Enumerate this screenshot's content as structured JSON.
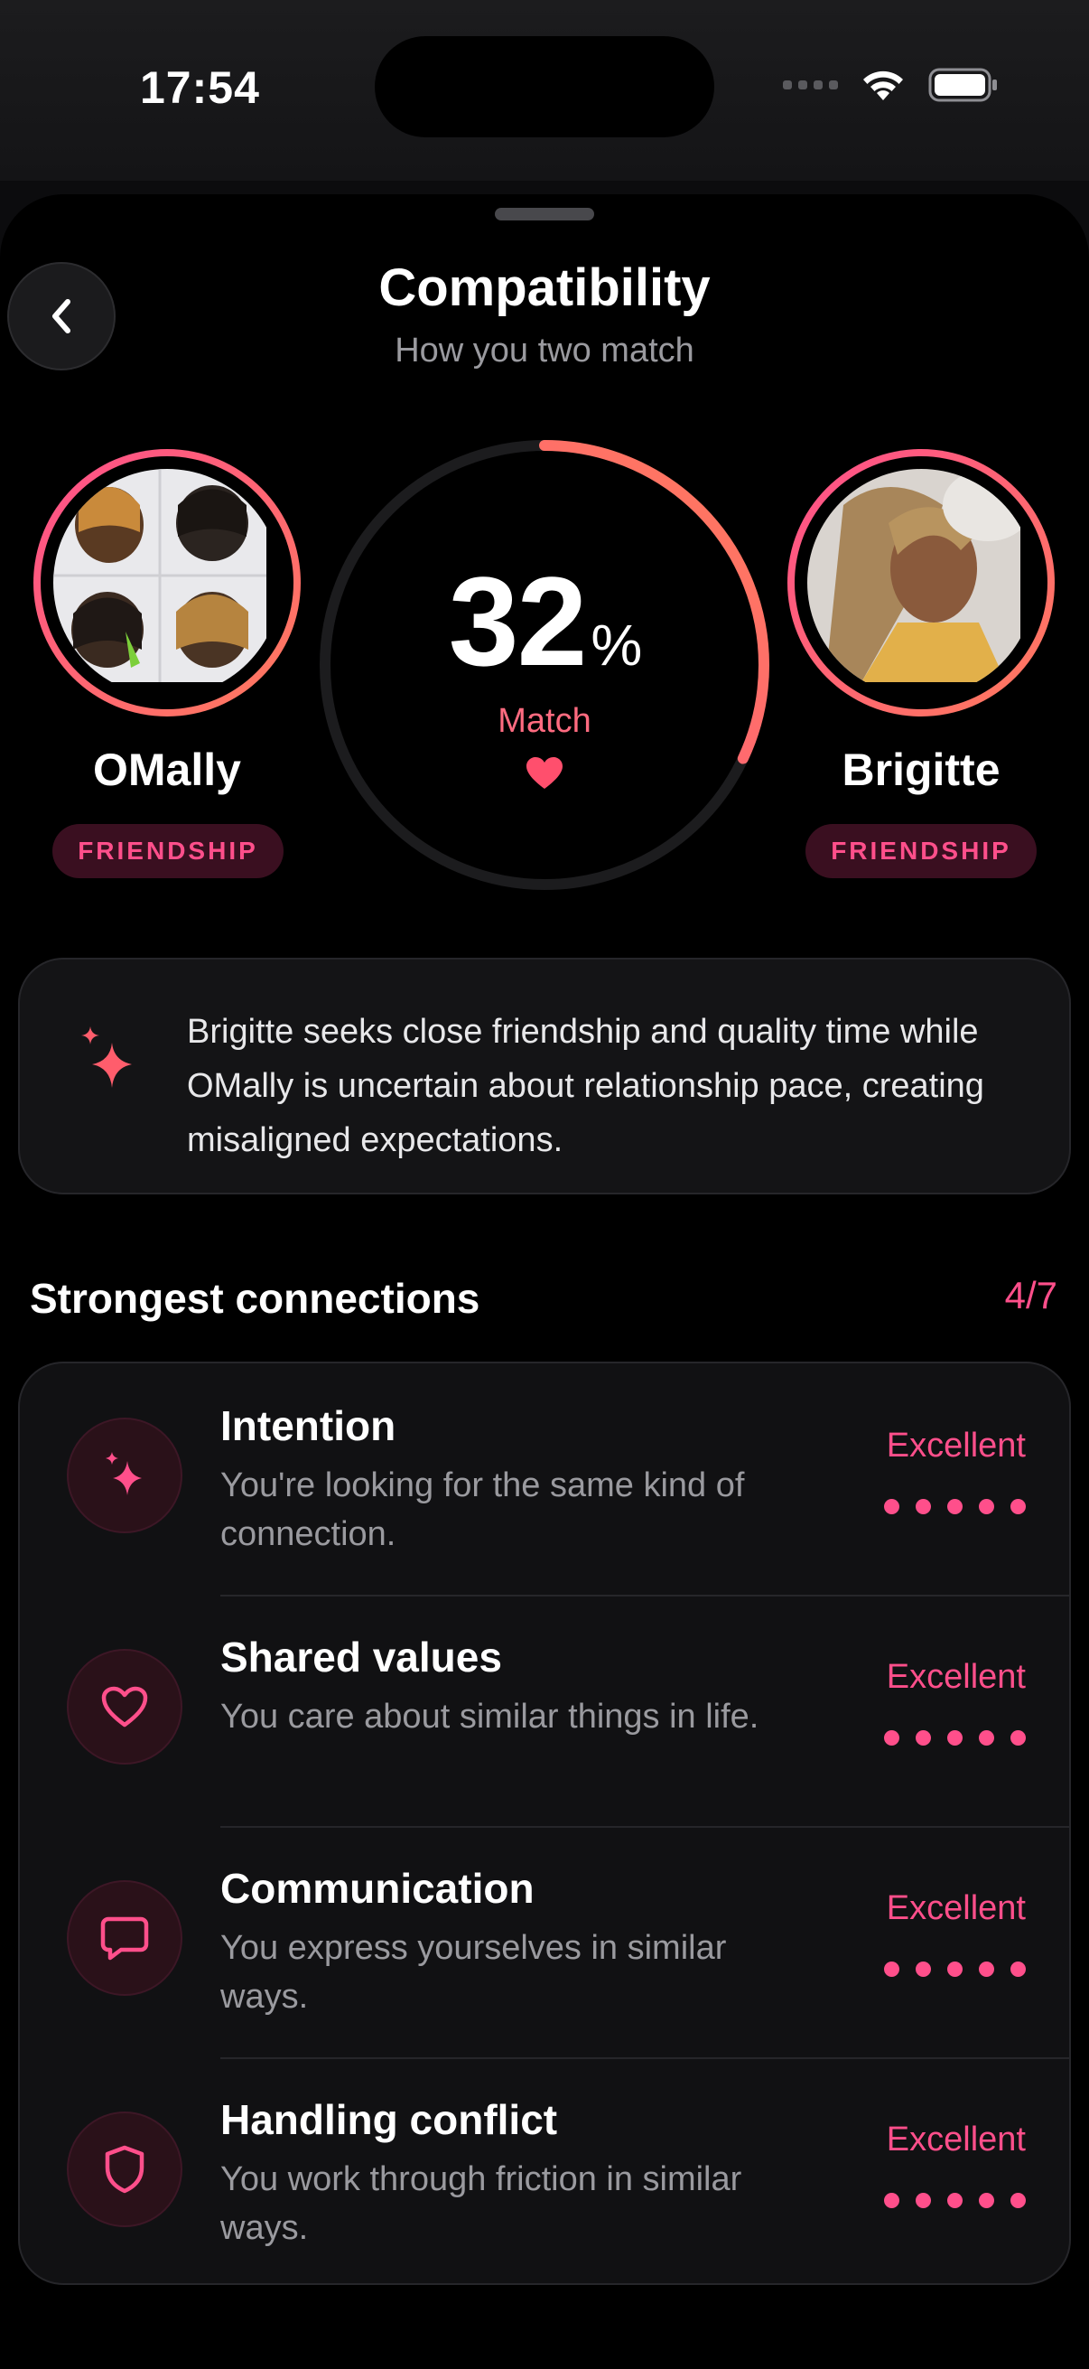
{
  "status_bar": {
    "time": "17:54"
  },
  "header": {
    "title": "Compatibility",
    "subtitle": "How you two match"
  },
  "match": {
    "percent_value": "32",
    "percent_sign": "%",
    "label": "Match",
    "fraction": 0.32
  },
  "profiles": {
    "left": {
      "name": "OMally",
      "badge": "FRIENDSHIP"
    },
    "right": {
      "name": "Brigitte",
      "badge": "FRIENDSHIP"
    }
  },
  "insight": {
    "text": "Brigitte seeks close friendship and quality time while OMally is uncertain about relationship pace, creating misaligned expectations."
  },
  "connections": {
    "title": "Strongest connections",
    "count": "4/7",
    "items": [
      {
        "title": "Intention",
        "description": "You're looking for the same kind of connection.",
        "rating": "Excellent",
        "dots": 5,
        "icon": "sparkle-icon"
      },
      {
        "title": "Shared values",
        "description": "You care about similar things in life.",
        "rating": "Excellent",
        "dots": 5,
        "icon": "heart-icon"
      },
      {
        "title": "Communication",
        "description": "You express yourselves in similar ways.",
        "rating": "Excellent",
        "dots": 5,
        "icon": "chat-bubble-icon"
      },
      {
        "title": "Handling conflict",
        "description": "You work through friction in similar ways.",
        "rating": "Excellent",
        "dots": 5,
        "icon": "shield-icon"
      }
    ]
  },
  "colors": {
    "accent": "#ff4f8b",
    "accent_orange": "#ff7b5c",
    "background": "#000000",
    "card": "#141416"
  }
}
